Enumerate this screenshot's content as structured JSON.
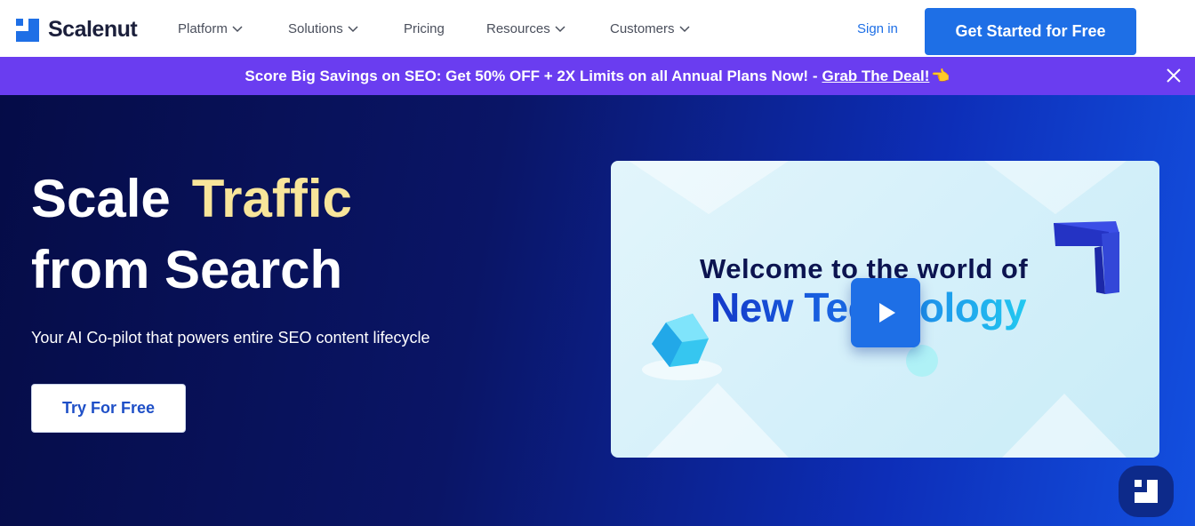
{
  "header": {
    "brand": "Scalenut",
    "nav": [
      {
        "label": "Platform",
        "dropdown": true
      },
      {
        "label": "Solutions",
        "dropdown": true
      },
      {
        "label": "Pricing",
        "dropdown": false
      },
      {
        "label": "Resources",
        "dropdown": true
      },
      {
        "label": "Customers",
        "dropdown": true
      }
    ],
    "sign_in": "Sign in",
    "cta": "Get Started for Free"
  },
  "banner": {
    "text": "Score Big Savings on SEO: Get 50% OFF + 2X Limits on all Annual Plans Now! -",
    "link": "Grab The Deal!",
    "emoji": "👈"
  },
  "hero": {
    "title_word1": "Scale",
    "title_highlight": "Traffic",
    "title_line2": "from Search",
    "subtitle": "Your AI Co-pilot that powers entire SEO content lifecycle",
    "button": "Try For Free"
  },
  "video": {
    "line1": "Welcome to the world of",
    "line2": "New Technology"
  },
  "colors": {
    "brand_blue": "#1e6fe6",
    "banner_purple": "#6a3df0",
    "hero_dark": "#050c47",
    "highlight_yellow": "#f8e59a"
  }
}
